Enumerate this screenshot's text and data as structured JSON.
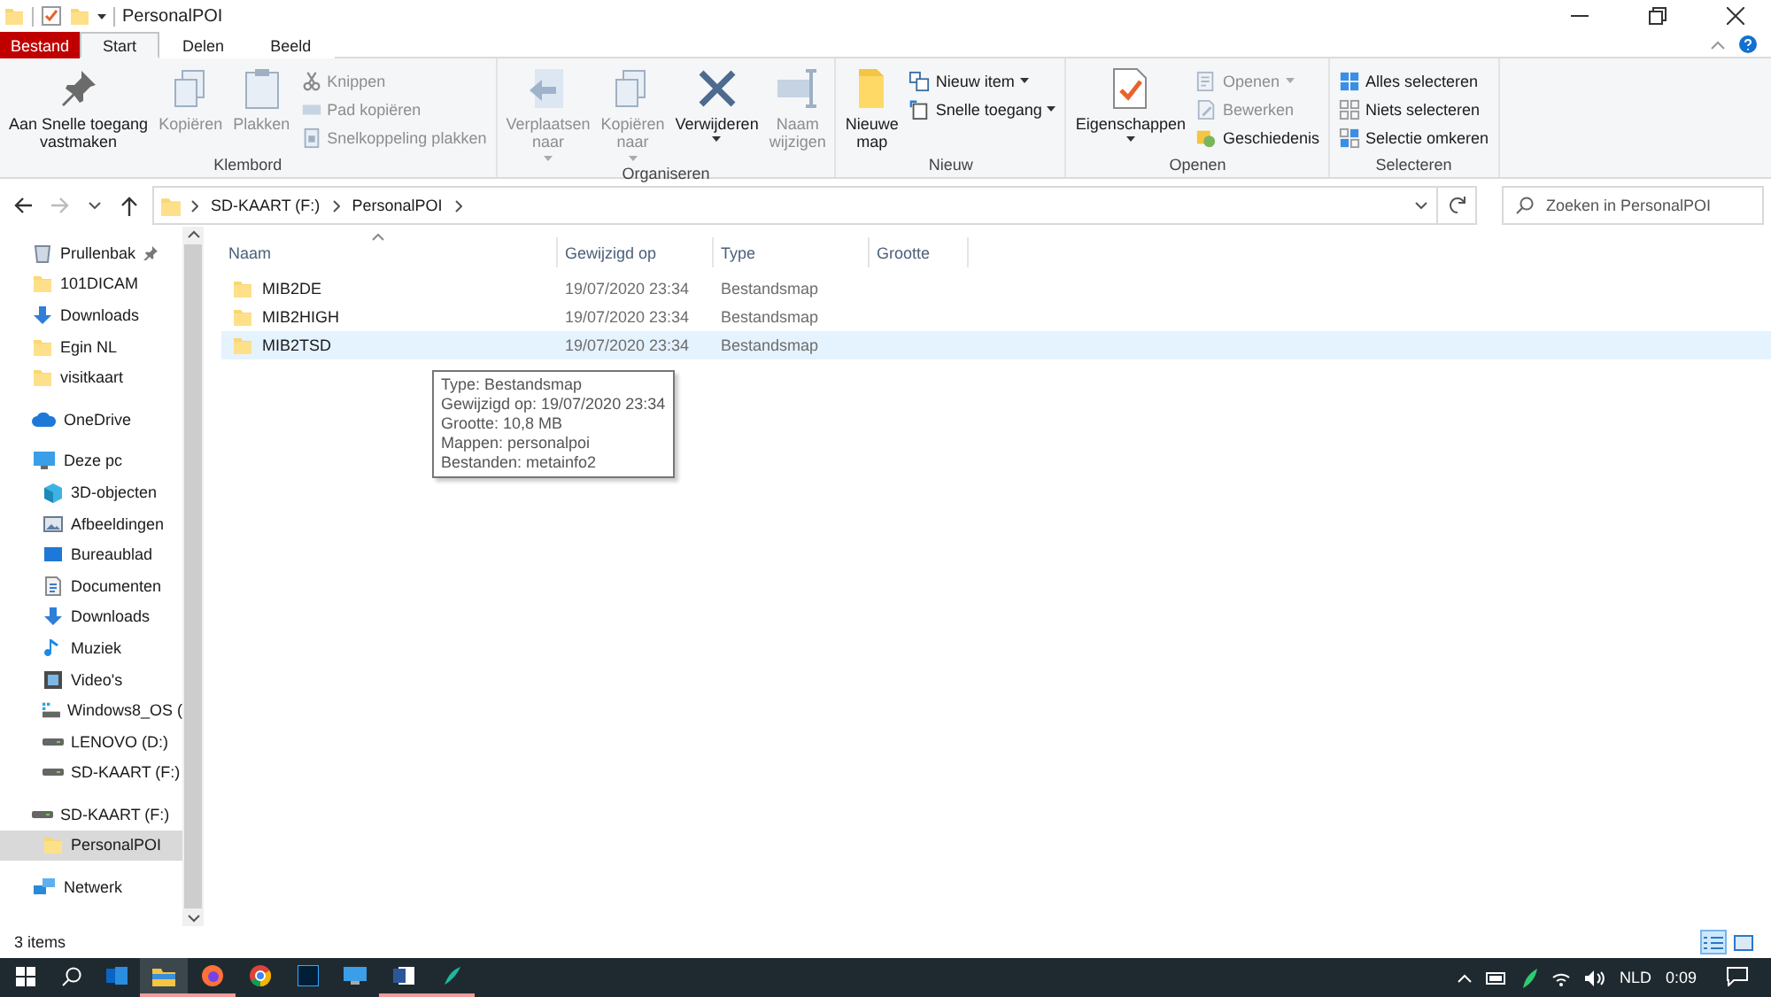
{
  "window": {
    "title": "PersonalPOI"
  },
  "ribbon_tabs": [
    {
      "label": "Bestand",
      "kind": "file"
    },
    {
      "label": "Start",
      "kind": "tab",
      "selected": true
    },
    {
      "label": "Delen",
      "kind": "tab",
      "selected": false
    },
    {
      "label": "Beeld",
      "kind": "tab",
      "selected": false
    }
  ],
  "ribbon_groups": [
    {
      "label": "Klembord",
      "items": [
        {
          "label": "Aan Snelle toegang\nvastmaken",
          "kind": "pin",
          "large": true,
          "disabled": false,
          "dropdown": false
        },
        {
          "label": "Kopiëren",
          "kind": "copy",
          "large": true,
          "disabled": true,
          "dropdown": false
        },
        {
          "label": "Plakken",
          "kind": "clipboard",
          "large": true,
          "disabled": true,
          "dropdown": false
        },
        {
          "label": "Knippen",
          "kind": "scissors",
          "large": false,
          "disabled": true,
          "dropdown": false
        },
        {
          "label": "Pad kopiëren",
          "kind": "path",
          "large": false,
          "disabled": true,
          "dropdown": false
        },
        {
          "label": "Snelkoppeling plakken",
          "kind": "shortcut",
          "large": false,
          "disabled": true,
          "dropdown": false
        }
      ]
    },
    {
      "label": "Organiseren",
      "items": [
        {
          "label": "Verplaatsen\nnaar",
          "kind": "move",
          "large": true,
          "disabled": true,
          "dropdown": true
        },
        {
          "label": "Kopiëren\nnaar",
          "kind": "copyto",
          "large": true,
          "disabled": true,
          "dropdown": true
        },
        {
          "label": "Verwijderen",
          "kind": "delete",
          "large": true,
          "disabled": false,
          "dropdown": true
        },
        {
          "label": "Naam\nwijzigen",
          "kind": "rename",
          "large": true,
          "disabled": true,
          "dropdown": false
        }
      ]
    },
    {
      "label": "Nieuw",
      "items": [
        {
          "label": "Nieuwe\nmap",
          "kind": "newfolder",
          "large": true,
          "disabled": false,
          "dropdown": false
        },
        {
          "label": "Nieuw item",
          "kind": "newitem",
          "large": false,
          "disabled": false,
          "dropdown": true
        },
        {
          "label": "Snelle toegang",
          "kind": "easyaccess",
          "large": false,
          "disabled": false,
          "dropdown": true
        }
      ]
    },
    {
      "label": "Openen",
      "items": [
        {
          "label": "Eigenschappen",
          "kind": "properties",
          "large": true,
          "disabled": false,
          "dropdown": true
        },
        {
          "label": "Openen",
          "kind": "open",
          "large": false,
          "disabled": true,
          "dropdown": true
        },
        {
          "label": "Bewerken",
          "kind": "edit",
          "large": false,
          "disabled": true,
          "dropdown": false
        },
        {
          "label": "Geschiedenis",
          "kind": "history",
          "large": false,
          "disabled": false,
          "dropdown": false
        }
      ]
    },
    {
      "label": "Selecteren",
      "items": [
        {
          "label": "Alles selecteren",
          "kind": "selectall",
          "large": false,
          "disabled": false,
          "dropdown": false
        },
        {
          "label": "Niets selecteren",
          "kind": "selectnone",
          "large": false,
          "disabled": false,
          "dropdown": false
        },
        {
          "label": "Selectie omkeren",
          "kind": "invert",
          "large": false,
          "disabled": false,
          "dropdown": false
        }
      ]
    }
  ],
  "address_bar": {
    "segments": [
      "SD-KAART (F:)",
      "PersonalPOI"
    ],
    "forward_disabled": true
  },
  "search": {
    "placeholder": "Zoeken in PersonalPOI"
  },
  "sidebar": {
    "items": [
      {
        "label": "Prullenbak",
        "kind": "recycle",
        "pinned": true,
        "selected": false
      },
      {
        "label": "101DICAM",
        "kind": "folder",
        "pinned": false,
        "selected": false
      },
      {
        "label": "Downloads",
        "kind": "download",
        "pinned": false,
        "selected": false
      },
      {
        "label": "Egin NL",
        "kind": "folder",
        "pinned": false,
        "selected": false
      },
      {
        "label": "visitkaart",
        "kind": "folder",
        "pinned": false,
        "selected": false
      },
      {
        "label": "OneDrive",
        "kind": "cloud",
        "pinned": false,
        "selected": false
      },
      {
        "label": "Deze pc",
        "kind": "pc",
        "pinned": false,
        "selected": false,
        "children": [
          {
            "label": "3D-objecten",
            "kind": "cube",
            "pinned": false,
            "selected": false
          },
          {
            "label": "Afbeeldingen",
            "kind": "image",
            "pinned": false,
            "selected": false
          },
          {
            "label": "Bureaublad",
            "kind": "desktop",
            "pinned": false,
            "selected": false
          },
          {
            "label": "Documenten",
            "kind": "document",
            "pinned": false,
            "selected": false
          },
          {
            "label": "Downloads",
            "kind": "download",
            "pinned": false,
            "selected": false
          },
          {
            "label": "Muziek",
            "kind": "music",
            "pinned": false,
            "selected": false
          },
          {
            "label": "Video's",
            "kind": "video",
            "pinned": false,
            "selected": false
          },
          {
            "label": "Windows8_OS (",
            "kind": "osdrive",
            "pinned": false,
            "selected": false
          },
          {
            "label": "LENOVO (D:)",
            "kind": "drive",
            "pinned": false,
            "selected": false
          },
          {
            "label": "SD-KAART (F:)",
            "kind": "drive",
            "pinned": false,
            "selected": false
          }
        ]
      },
      {
        "label": "SD-KAART (F:)",
        "kind": "drive",
        "pinned": false,
        "selected": false,
        "children": [
          {
            "label": "PersonalPOI",
            "kind": "folder",
            "pinned": false,
            "selected": true
          }
        ]
      },
      {
        "label": "Netwerk",
        "kind": "network",
        "pinned": false,
        "selected": false
      }
    ]
  },
  "table": {
    "columns": [
      {
        "label": "Naam",
        "sorted": true
      },
      {
        "label": "Gewijzigd op",
        "sorted": false
      },
      {
        "label": "Type",
        "sorted": false
      },
      {
        "label": "Grootte",
        "sorted": false
      }
    ],
    "rows": [
      {
        "name": "MIB2DE",
        "modified": "19/07/2020 23:34",
        "type": "Bestandsmap",
        "selected": false
      },
      {
        "name": "MIB2HIGH",
        "modified": "19/07/2020 23:34",
        "type": "Bestandsmap",
        "selected": false
      },
      {
        "name": "MIB2TSD",
        "modified": "19/07/2020 23:34",
        "type": "Bestandsmap",
        "selected": true
      }
    ]
  },
  "tooltip": {
    "lines": [
      "Type: Bestandsmap",
      "Gewijzigd op: 19/07/2020 23:34",
      "Grootte: 10,8 MB",
      "Mappen: personalpoi",
      "Bestanden: metainfo2"
    ]
  },
  "status_bar": {
    "text": "3 items",
    "views": [
      {
        "kind": "details",
        "selected": true
      },
      {
        "kind": "thumbnails",
        "selected": false
      }
    ]
  },
  "taskbar": {
    "apps": [
      {
        "kind": "outlook",
        "running": false,
        "selected": false
      },
      {
        "kind": "explorer",
        "running": true,
        "selected": true
      },
      {
        "kind": "firefox",
        "running": true,
        "selected": false
      },
      {
        "kind": "chrome",
        "running": false,
        "selected": false
      },
      {
        "kind": "photoshop",
        "running": false,
        "selected": false
      },
      {
        "kind": "monitor",
        "running": false,
        "selected": false
      },
      {
        "kind": "word",
        "running": true,
        "selected": false
      },
      {
        "kind": "app",
        "running": true,
        "selected": false
      }
    ],
    "language": "NLD",
    "time": "0:09"
  }
}
